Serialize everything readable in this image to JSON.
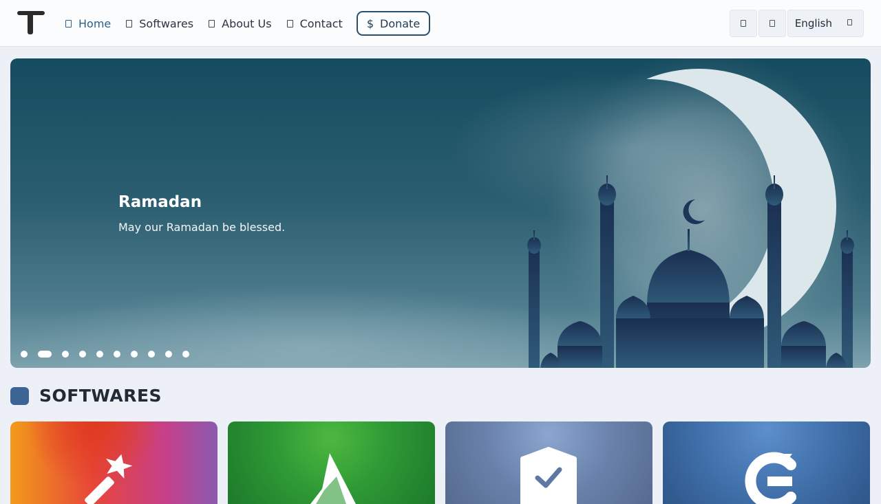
{
  "nav": {
    "items": [
      {
        "label": "Home",
        "icon": "home-icon",
        "active": true
      },
      {
        "label": "Softwares",
        "icon": "box-icon"
      },
      {
        "label": "About Us",
        "icon": "info-icon"
      },
      {
        "label": "Contact",
        "icon": "mail-icon"
      }
    ],
    "donate": {
      "symbol": "$",
      "label": "Donate"
    }
  },
  "header_right": {
    "buttons": [
      {
        "icon": "theme-toggle-icon"
      },
      {
        "icon": "search-icon"
      }
    ],
    "language": {
      "label": "English",
      "icon": "chevron-down-icon"
    }
  },
  "hero": {
    "title": "Ramadan",
    "subtitle": "May our Ramadan be blessed.",
    "slide_count": 10,
    "active_slide_index": 1
  },
  "softwares": {
    "title": "SOFTWARES",
    "cards": [
      {
        "icon": "magic-wand-icon",
        "color": "#e7463a"
      },
      {
        "icon": "horn-icon",
        "color": "#2f9a35"
      },
      {
        "icon": "shield-check-icon",
        "color": "#6a82ab"
      },
      {
        "icon": "g-logo-icon",
        "color": "#3f6ea8"
      }
    ]
  },
  "colors": {
    "accent": "#2e5f86",
    "section_mark": "#3c6596"
  }
}
